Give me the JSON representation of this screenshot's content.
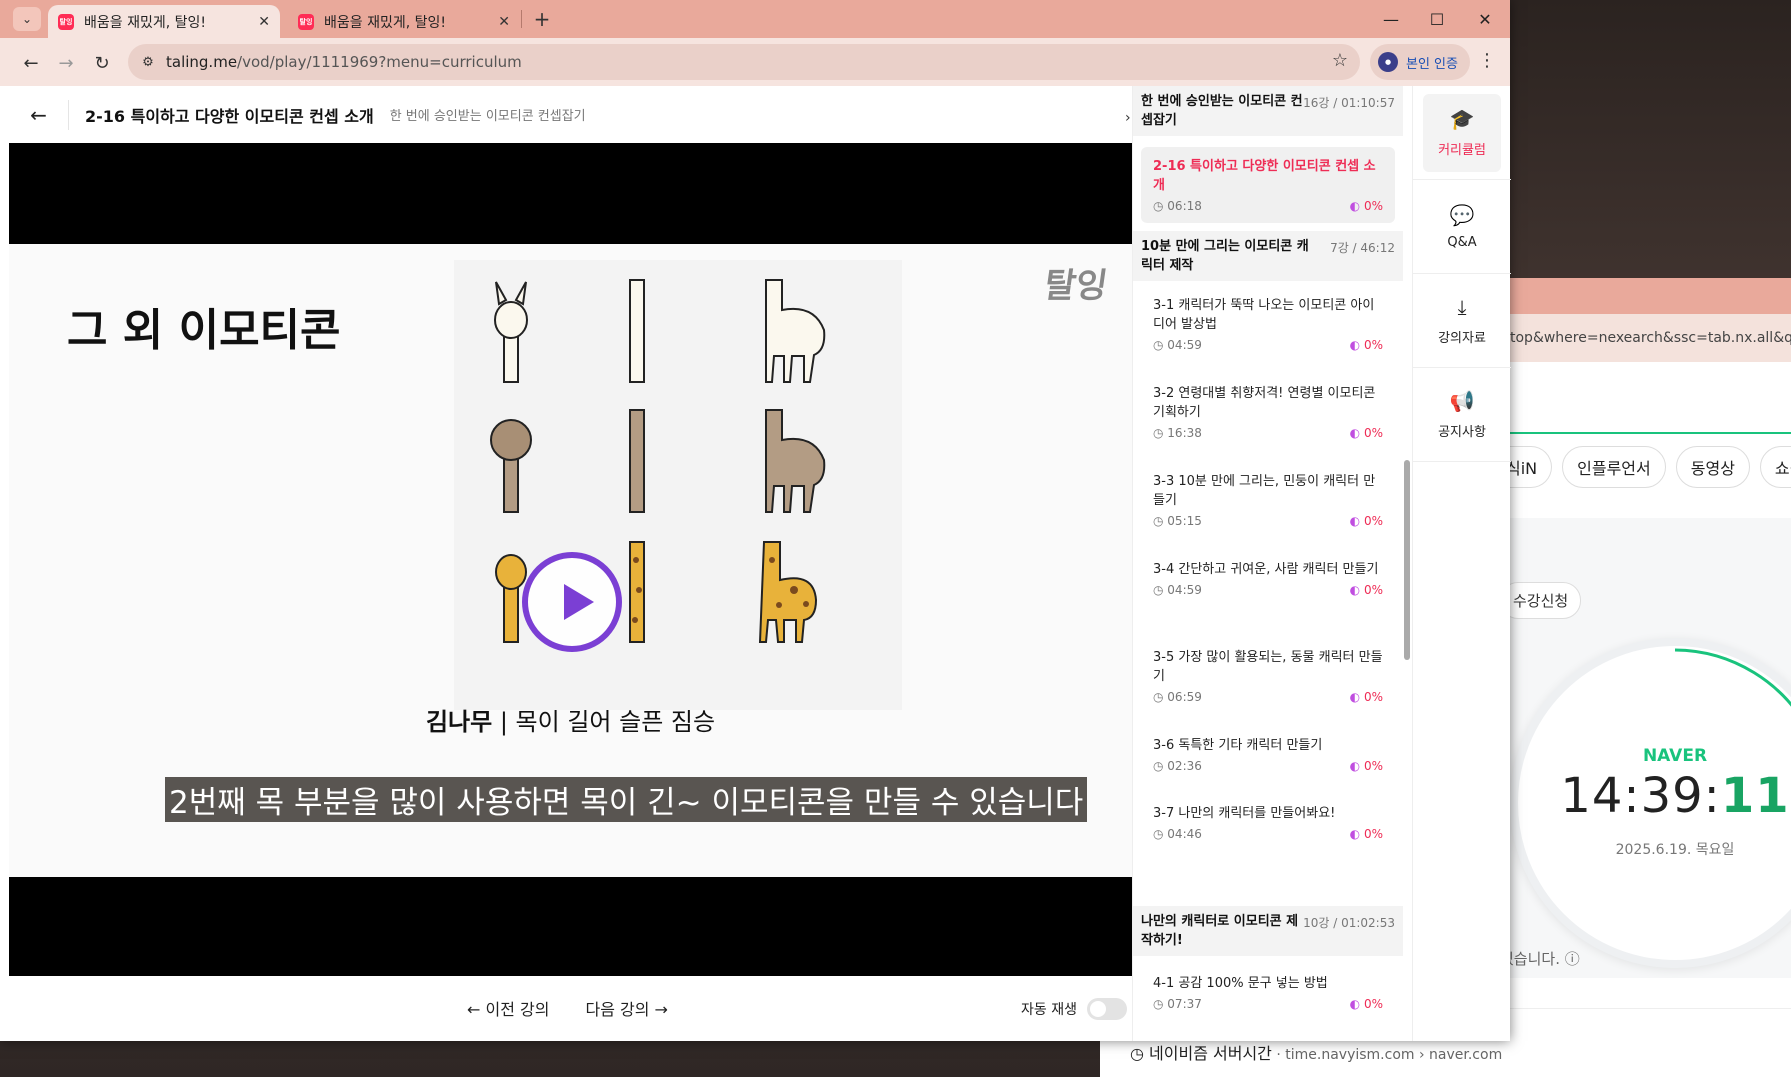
{
  "browser": {
    "tabs": [
      {
        "title": "배움을 재밌게, 탈잉!",
        "favicon": "탈잉",
        "active": true
      },
      {
        "title": "배움을 재밌게, 탈잉!",
        "favicon": "탈잉",
        "active": false
      }
    ],
    "url_host": "taling.me",
    "url_path": "/vod/play/1111969?menu=curriculum",
    "verify_label": "본인 인증",
    "tab_list_icon": "chevron-down-icon",
    "window_controls": [
      "minimize-icon",
      "maximize-icon",
      "close-icon"
    ]
  },
  "header": {
    "lesson_title": "2-16 특이하고 다양한 이모티콘 컨셉 소개",
    "chapter_title": "한 번에 승인받는 이모티콘 컨셉잡기"
  },
  "slide": {
    "title": "그 외 이모티콘",
    "logo": "탈잉",
    "caption_author": "김나무",
    "caption_text": " | 목이 길어 슬픈 짐승",
    "subtitle": "2번째 목 부분을 많이 사용하면 목이 긴~ 이모티콘을 만들 수 있습니다"
  },
  "footer": {
    "prev_label": "이전 강의",
    "next_label": "다음 강의",
    "autoplay_label": "자동 재생",
    "autoplay_on": false
  },
  "curriculum": {
    "sections": [
      {
        "title": "한 번에 승인받는 이모티콘 컨셉잡기",
        "meta": "16강 / 01:10:57"
      },
      {
        "title": "10분 만에 그리는 이모티콘 캐릭터 제작",
        "meta": "7강 / 46:12"
      },
      {
        "title": "나만의 캐릭터로 이모티콘 제작하기!",
        "meta": "10강 / 01:02:53"
      }
    ],
    "items": [
      {
        "title": "2-16 특이하고 다양한 이모티콘 컨셉 소개",
        "duration": "06:18",
        "progress": "0%",
        "current": true
      },
      {
        "title": "3-1 캐릭터가 뚝딱 나오는 이모티콘 아이디어 발상법",
        "duration": "04:59",
        "progress": "0%"
      },
      {
        "title": "3-2 연령대별 취향저격! 연령별 이모티콘 기획하기",
        "duration": "16:38",
        "progress": "0%"
      },
      {
        "title": "3-3 10분 만에 그리는, 민둥이 캐릭터 만들기",
        "duration": "05:15",
        "progress": "0%"
      },
      {
        "title": "3-4 간단하고 귀여운, 사람 캐릭터 만들기",
        "duration": "04:59",
        "progress": "0%"
      },
      {
        "title": "3-5 가장 많이 활용되는, 동물 캐릭터 만들기",
        "duration": "06:59",
        "progress": "0%"
      },
      {
        "title": "3-6 독특한 기타 캐릭터 만들기",
        "duration": "02:36",
        "progress": "0%"
      },
      {
        "title": "3-7 나만의 캐릭터를 만들어봐요!",
        "duration": "04:46",
        "progress": "0%"
      },
      {
        "title": "4-1 공감 100% 문구 넣는 방법",
        "duration": "07:37",
        "progress": "0%"
      }
    ]
  },
  "side_menu": [
    {
      "label": "커리큘럼",
      "icon": "graduation-cap-icon",
      "active": true
    },
    {
      "label": "Q&A",
      "icon": "chat-bubble-icon"
    },
    {
      "label": "강의자료",
      "icon": "download-icon"
    },
    {
      "label": "공지사항",
      "icon": "megaphone-icon"
    }
  ],
  "background_window": {
    "url_fragment": "top&where=nexearch&ssc=tab.nx.all&query",
    "chips": [
      "식iN",
      "인플루언서",
      "동영상",
      "쇼핑"
    ],
    "register_label": "수강신청",
    "clock_brand": "NAVER",
    "clock_time": "14:39:",
    "clock_seconds": "11",
    "clock_date": "2025.6.19. 목요일",
    "note": "있습니다. ⓘ",
    "result_title": "네이비즘 서버시간",
    "result_crumb": " · time.navyism.com › naver.com"
  },
  "colors": {
    "brand": "#ee2c55",
    "play_accent": "#7b3fd4",
    "naver_green": "#19c37d",
    "tab_strip": "#e9a99b"
  }
}
